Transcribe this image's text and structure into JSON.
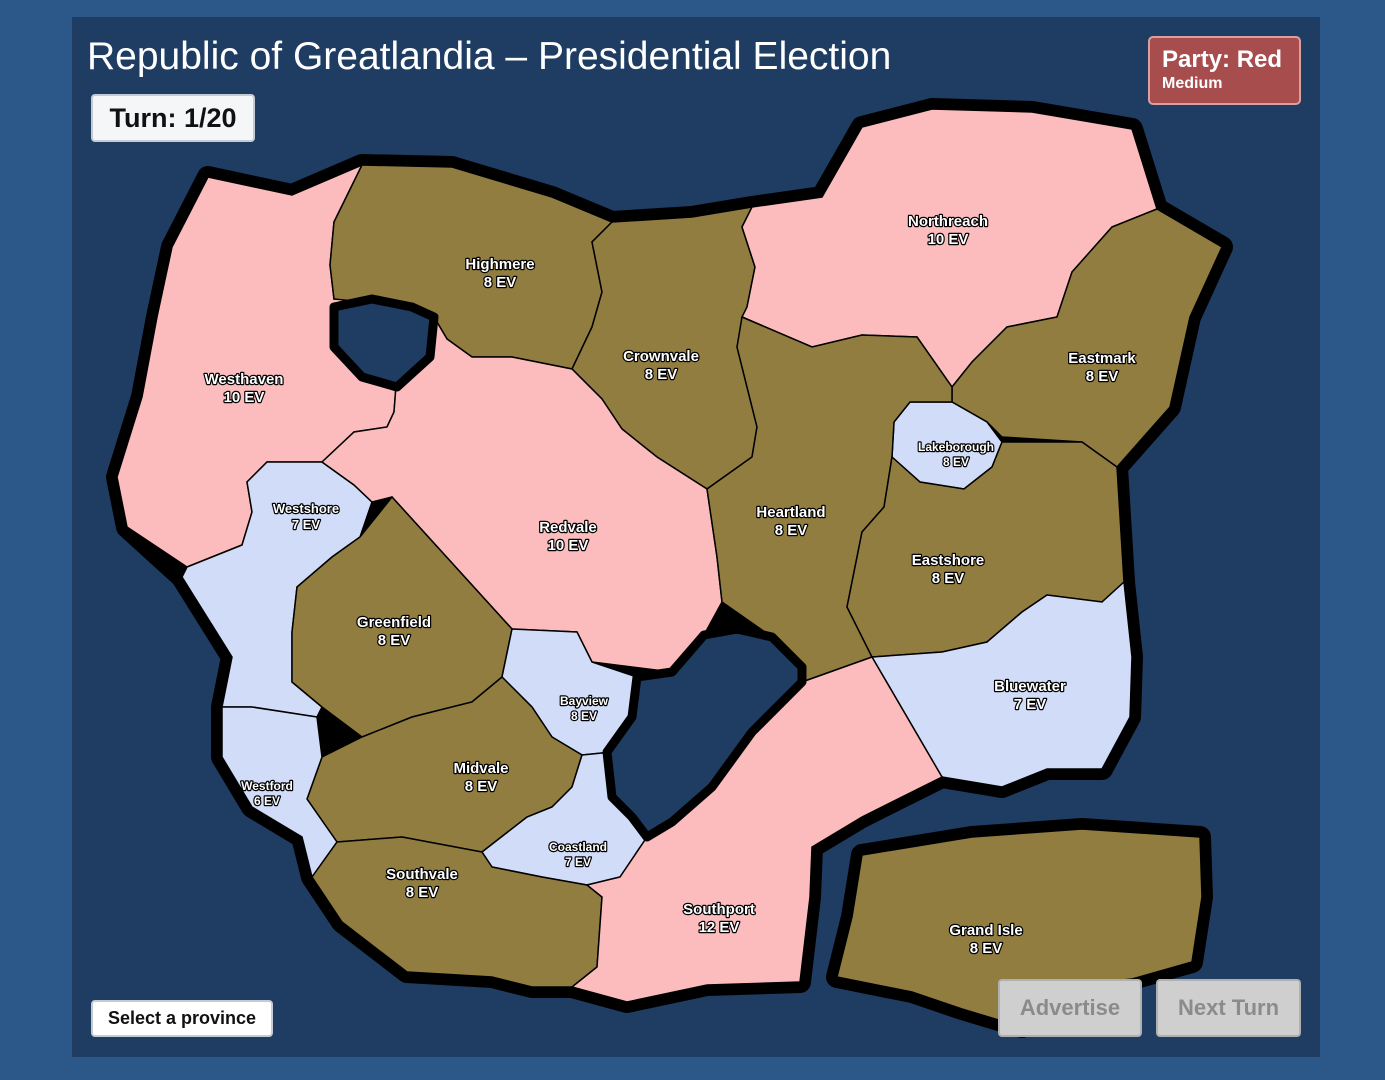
{
  "header": {
    "title": "Republic of Greatlandia – Presidential Election",
    "turn": "Turn: 1/20",
    "party": "Party: Red",
    "difficulty": "Medium"
  },
  "colors": {
    "red_party": "#fcbcbd",
    "blue_party": "#d1dcf8",
    "neutral": "#927d40",
    "water": "#1f3c63",
    "border": "#000000",
    "page_bg": "#2b5789"
  },
  "provinces": [
    {
      "id": "westhaven",
      "name": "Westhaven",
      "ev": "10 EV",
      "control": "red"
    },
    {
      "id": "highmere",
      "name": "Highmere",
      "ev": "8 EV",
      "control": "neutral"
    },
    {
      "id": "crownvale",
      "name": "Crownvale",
      "ev": "8 EV",
      "control": "neutral"
    },
    {
      "id": "northreach",
      "name": "Northreach",
      "ev": "10 EV",
      "control": "red"
    },
    {
      "id": "eastmark",
      "name": "Eastmark",
      "ev": "8 EV",
      "control": "neutral"
    },
    {
      "id": "lakeborough",
      "name": "Lakeborough",
      "ev": "8 EV",
      "control": "blue"
    },
    {
      "id": "westshore",
      "name": "Westshore",
      "ev": "7 EV",
      "control": "blue"
    },
    {
      "id": "redvale",
      "name": "Redvale",
      "ev": "10 EV",
      "control": "red"
    },
    {
      "id": "heartland",
      "name": "Heartland",
      "ev": "8 EV",
      "control": "neutral"
    },
    {
      "id": "eastshore",
      "name": "Eastshore",
      "ev": "8 EV",
      "control": "neutral"
    },
    {
      "id": "greenfield",
      "name": "Greenfield",
      "ev": "8 EV",
      "control": "neutral"
    },
    {
      "id": "bayview",
      "name": "Bayview",
      "ev": "8 EV",
      "control": "blue"
    },
    {
      "id": "bluewater",
      "name": "Bluewater",
      "ev": "7 EV",
      "control": "blue"
    },
    {
      "id": "midvale",
      "name": "Midvale",
      "ev": "8 EV",
      "control": "neutral"
    },
    {
      "id": "westford",
      "name": "Westford",
      "ev": "6 EV",
      "control": "blue"
    },
    {
      "id": "coastland",
      "name": "Coastland",
      "ev": "7 EV",
      "control": "blue"
    },
    {
      "id": "southvale",
      "name": "Southvale",
      "ev": "8 EV",
      "control": "neutral"
    },
    {
      "id": "southport",
      "name": "Southport",
      "ev": "12 EV",
      "control": "red"
    },
    {
      "id": "grandisle",
      "name": "Grand Isle",
      "ev": "8 EV",
      "control": "neutral"
    }
  ],
  "footer": {
    "status": "Select a province",
    "advertise_label": "Advertise",
    "next_turn_label": "Next Turn"
  }
}
